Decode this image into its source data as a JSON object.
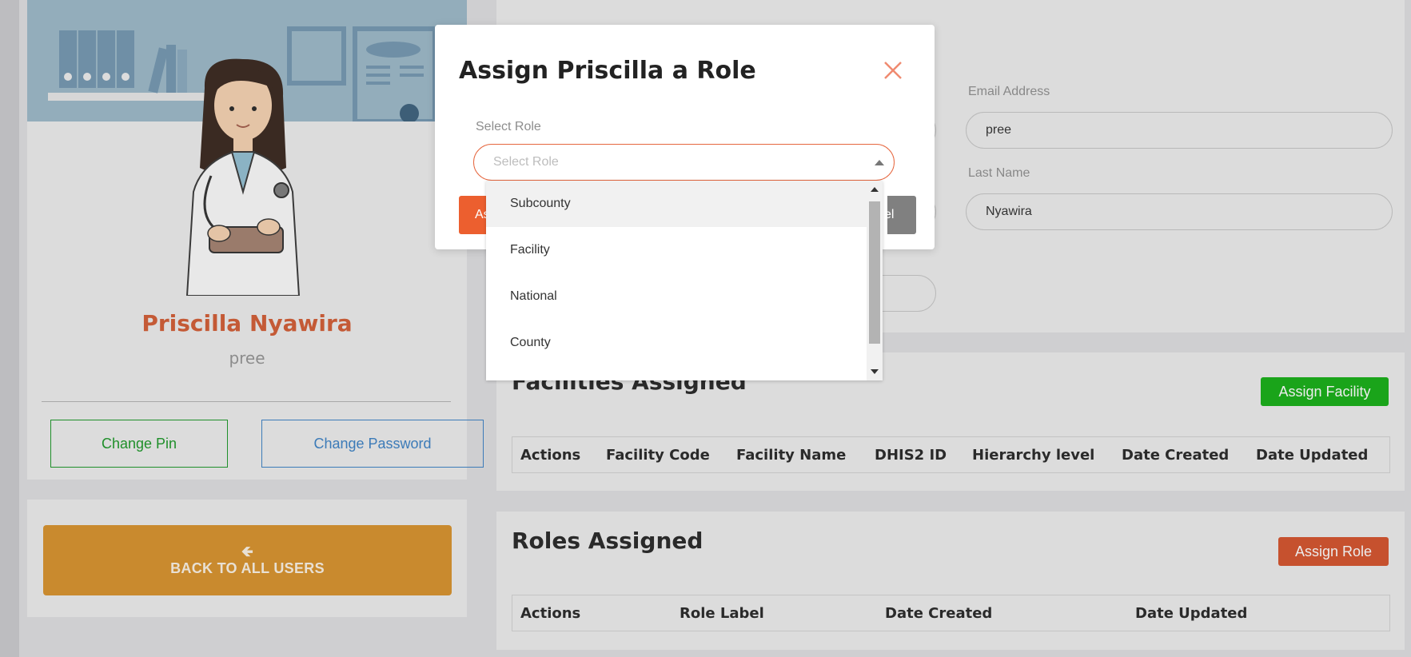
{
  "profile": {
    "full_name": "Priscilla Nyawira",
    "username": "pree",
    "change_pin_label": "Change Pin",
    "change_password_label": "Change Password"
  },
  "back": {
    "label": "BACK TO ALL USERS",
    "icon": "arrow-left-icon"
  },
  "details": {
    "email_label": "Email Address",
    "email_value": "pree",
    "last_name_label": "Last Name",
    "last_name_value": "Nyawira"
  },
  "facilities": {
    "title": "Facilities Assigned",
    "assign_button": "Assign Facility",
    "columns": [
      "Actions",
      "Facility Code",
      "Facility Name",
      "DHIS2 ID",
      "Hierarchy level",
      "Date Created",
      "Date Updated"
    ]
  },
  "roles": {
    "title": "Roles Assigned",
    "assign_button": "Assign Role",
    "columns": [
      "Actions",
      "Role Label",
      "Date Created",
      "Date Updated"
    ]
  },
  "modal": {
    "title": "Assign Priscilla a Role",
    "select_label": "Select Role",
    "select_placeholder": "Select Role",
    "assign_button": "As",
    "cancel_button": "el",
    "options": [
      "Subcounty",
      "Facility",
      "National",
      "County"
    ],
    "highlighted_option": "Subcounty"
  },
  "colors": {
    "accent_orange": "#ec5f2f",
    "name_color": "#c45a36",
    "green": "#1aa41a",
    "back_button": "#c98a2e"
  }
}
